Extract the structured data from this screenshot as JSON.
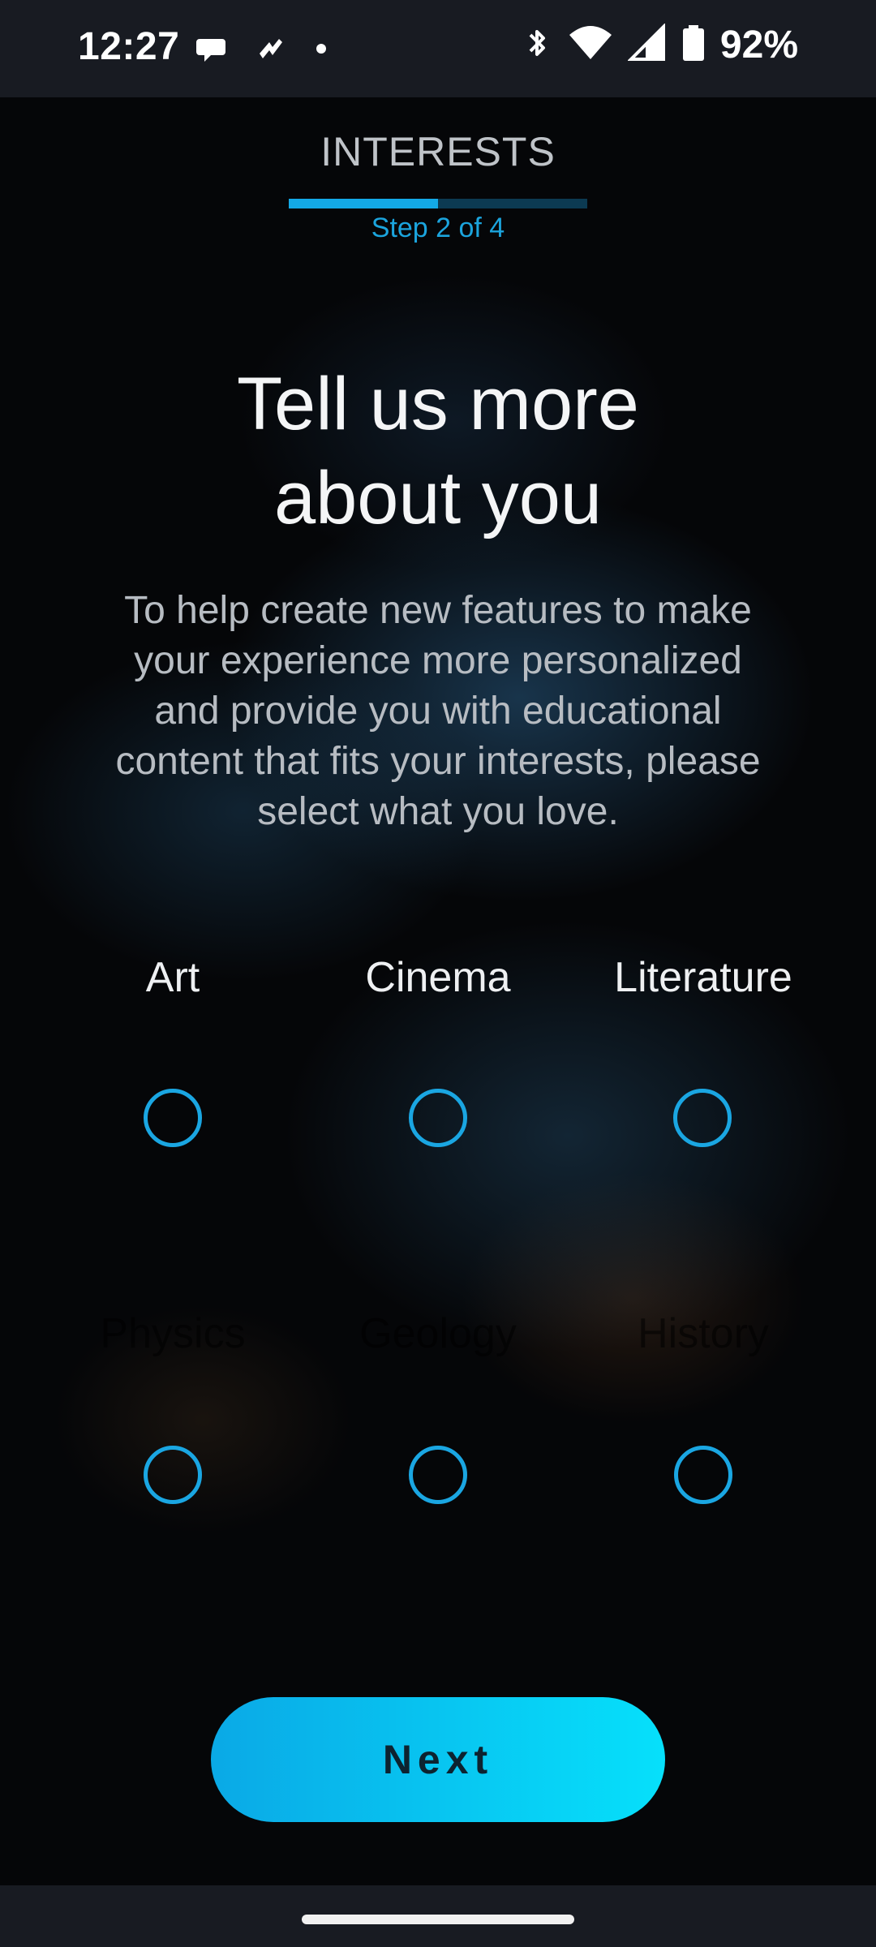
{
  "status_bar": {
    "time": "12:27",
    "battery_percent": "92%",
    "left_icons": [
      "chat-bubble-icon",
      "health-app-icon",
      "dot-icon"
    ],
    "right_icons": [
      "bluetooth-icon",
      "wifi-icon",
      "cell-signal-icon",
      "battery-icon"
    ]
  },
  "header": {
    "section_title": "INTERESTS",
    "step_label": "Step 2 of 4",
    "progress_fraction": 0.5
  },
  "main": {
    "heading_line1": "Tell us more",
    "heading_line2": "about you",
    "description": "To help create new features to make your experience more personalized and provide you with educational content that fits your interests, please select what you love."
  },
  "interests": [
    {
      "label": "Art",
      "selected": false
    },
    {
      "label": "Cinema",
      "selected": false
    },
    {
      "label": "Literature",
      "selected": false
    },
    {
      "label": "Physics",
      "selected": false
    },
    {
      "label": "Geology",
      "selected": false
    },
    {
      "label": "History",
      "selected": false
    }
  ],
  "footer": {
    "next_label": "Next"
  },
  "colors": {
    "accent": "#13a9e7",
    "button_start": "#0aa9e6",
    "button_end": "#06e0fb"
  }
}
